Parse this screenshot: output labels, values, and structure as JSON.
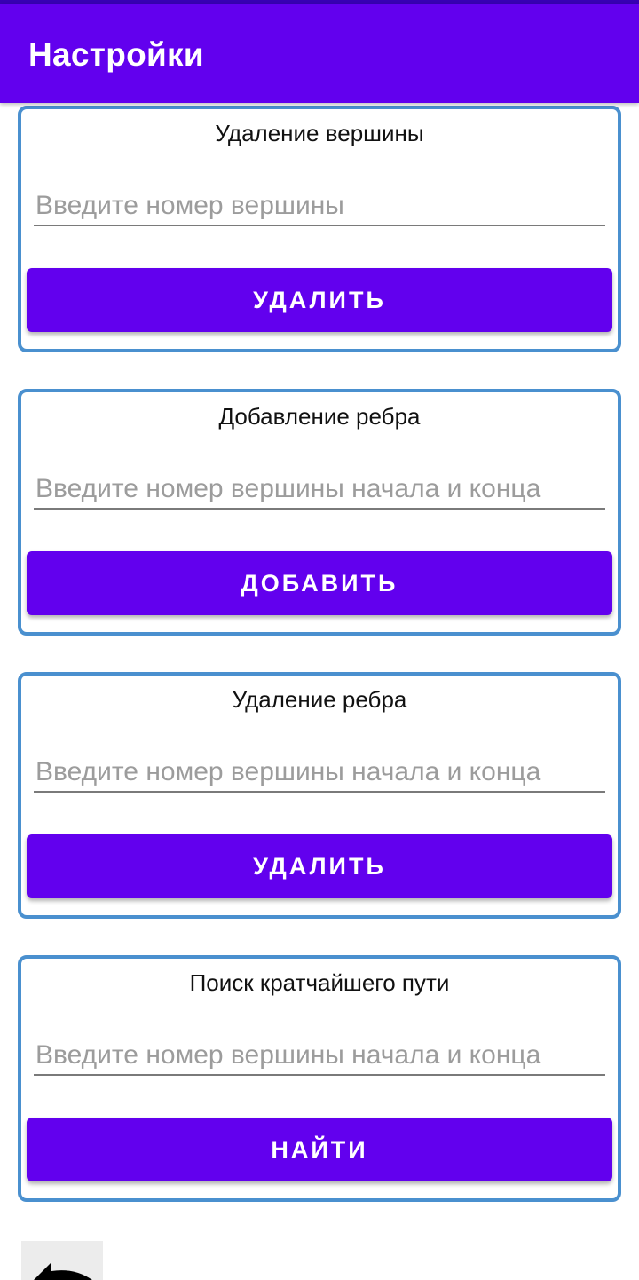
{
  "colors": {
    "brand": "#6200ee",
    "status_bar": "#3700b3",
    "card_border": "#4a90cf"
  },
  "app_bar": {
    "title": "Настройки"
  },
  "cards": [
    {
      "title": "Удаление вершины",
      "input_placeholder": "Введите номер вершины",
      "input_value": "",
      "button_label": "УДАЛИТЬ"
    },
    {
      "title": "Добавление ребра",
      "input_placeholder": "Введите номер вершины начала и конца",
      "input_value": "",
      "button_label": "ДОБАВИТЬ"
    },
    {
      "title": "Удаление ребра",
      "input_placeholder": "Введите номер вершины начала и конца",
      "input_value": "",
      "button_label": "УДАЛИТЬ"
    },
    {
      "title": "Поиск кратчайшего пути",
      "input_placeholder": "Введите номер вершины начала и конца",
      "input_value": "",
      "button_label": "НАЙТИ"
    }
  ],
  "back_button": {
    "icon": "back-arrow-icon"
  }
}
